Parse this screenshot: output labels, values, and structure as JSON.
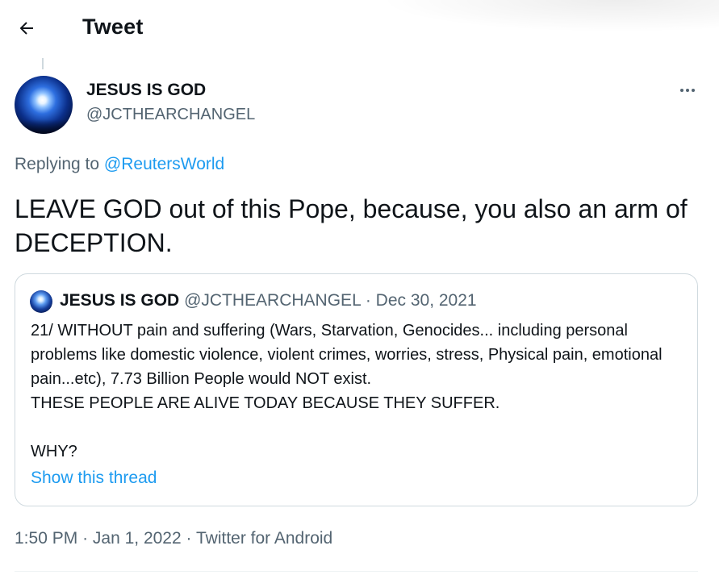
{
  "header": {
    "title": "Tweet",
    "back_icon": "arrow-left-icon"
  },
  "tweet": {
    "author": {
      "display_name": "JESUS IS GOD",
      "handle": "@JCTHEARCHANGEL",
      "avatar": "space-light-avatar"
    },
    "more_icon": "more-horizontal-icon",
    "replying_prefix": "Replying to",
    "replying_to": "@ReutersWorld",
    "text": "LEAVE GOD out of this Pope, because, you also an arm of DECEPTION.",
    "timestamp": {
      "time": "1:50 PM",
      "separator": "·",
      "date": "Jan 1, 2022",
      "source": "Twitter for Android"
    }
  },
  "quoted_tweet": {
    "display_name": "JESUS IS GOD",
    "handle": "@JCTHEARCHANGEL",
    "separator": "·",
    "date": "Dec 30, 2021",
    "body": "21/  WITHOUT pain and suffering (Wars, Starvation, Genocides... including personal problems like domestic violence, violent crimes, worries, stress, Physical pain, emotional pain...etc), 7.73 Billion People would NOT exist.\nTHESE PEOPLE ARE ALIVE TODAY BECAUSE THEY SUFFER.\n\nWHY?",
    "show_thread": "Show this thread"
  },
  "colors": {
    "text_primary": "#0f1419",
    "text_secondary": "#536471",
    "link": "#1d9bf0",
    "border": "#cfd9de"
  }
}
